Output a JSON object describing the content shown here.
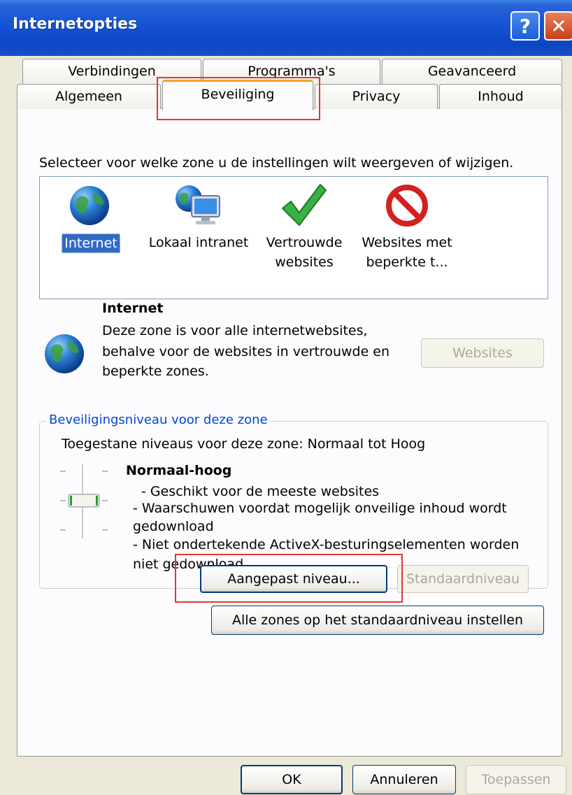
{
  "window": {
    "title": "Internetopties"
  },
  "tabs_row1": [
    "Verbindingen",
    "Programma's",
    "Geavanceerd"
  ],
  "tabs_row2": [
    "Algemeen",
    "Beveiliging",
    "Privacy",
    "Inhoud"
  ],
  "zone_prompt": "Selecteer voor welke zone u de instellingen wilt weergeven of wijzigen.",
  "zones": [
    {
      "label1": "Internet",
      "label2": "",
      "icon": "globe-icon"
    },
    {
      "label1": "Lokaal intranet",
      "label2": "",
      "icon": "intranet-icon"
    },
    {
      "label1": "Vertrouwde",
      "label2": "websites",
      "icon": "checkmark-icon"
    },
    {
      "label1": "Websites met",
      "label2": "beperkte t...",
      "icon": "restricted-icon"
    }
  ],
  "zone_info": {
    "title": "Internet",
    "desc1": "Deze zone is voor alle internetwebsites,",
    "desc2": "behalve voor de websites in vertrouwde en",
    "desc3": "beperkte zones.",
    "websites_button": "Websites"
  },
  "security": {
    "group_title": "Beveiligingsniveau voor deze zone",
    "allowed": "Toegestane niveaus voor deze zone: Normaal tot Hoog",
    "level": "Normaal-hoog",
    "line1": "- Geschikt voor de meeste websites",
    "line2": "- Waarschuwen voordat mogelijk onveilige inhoud wordt",
    "line3": "gedownload",
    "line4": "- Niet ondertekende ActiveX-besturingselementen worden",
    "line5": "niet gedownload",
    "custom_button": "Aangepast niveau...",
    "default_button": "Standaardniveau",
    "all_zones_button": "Alle zones op het standaardniveau instellen"
  },
  "footer": {
    "ok": "OK",
    "cancel": "Annuleren",
    "apply": "Toepassen"
  },
  "colors": {
    "accent": "#0c46c4",
    "highlight": "#e23636",
    "selection": "#316ac5"
  }
}
